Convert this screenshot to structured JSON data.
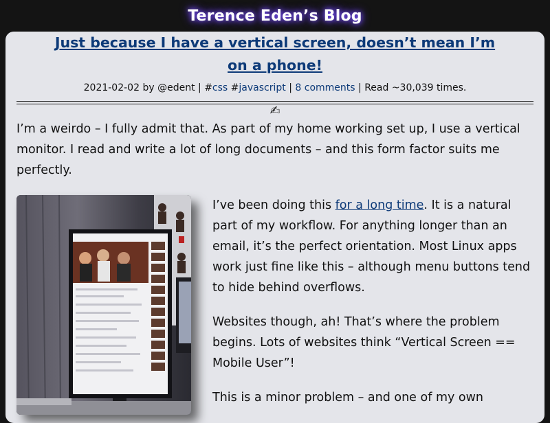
{
  "site": {
    "title": "Terence Eden’s Blog"
  },
  "post": {
    "title": "Just because I have a vertical screen, doesn’t mean I’m on a phone!",
    "meta": {
      "date": "2021-02-02",
      "by": "by",
      "author": "@edent",
      "sep1": "|",
      "hash1": "#",
      "tag1": "css",
      "hash2": "#",
      "tag2": "javascript",
      "sep2": "|",
      "comments": "8 comments",
      "sep3": "|",
      "reads": "Read ~30,039 times."
    },
    "divider_icon": "✍",
    "p1": "I’m a weirdo – I fully admit that. As part of my home working set up, I use a vertical monitor. I read and write a lot of long documents – and this form factor suits me perfectly.",
    "p2_before": "I’ve been doing this ",
    "p2_link": "for a long time",
    "p2_after": ". It is a natural part of my workflow. For anything longer than an email, it’s the perfect orientation. Most Linux apps work just fine like this – although menu buttons tend to hide behind overflows.",
    "p3": "Websites though, ah! That’s where the problem begins. Lots of websites think “Vertical Screen == Mobile User”!",
    "p4": "This is a minor problem – and one of my own"
  },
  "colors": {
    "link": "#0d3a78",
    "background": "#141414",
    "card": "#e4e5ea"
  }
}
